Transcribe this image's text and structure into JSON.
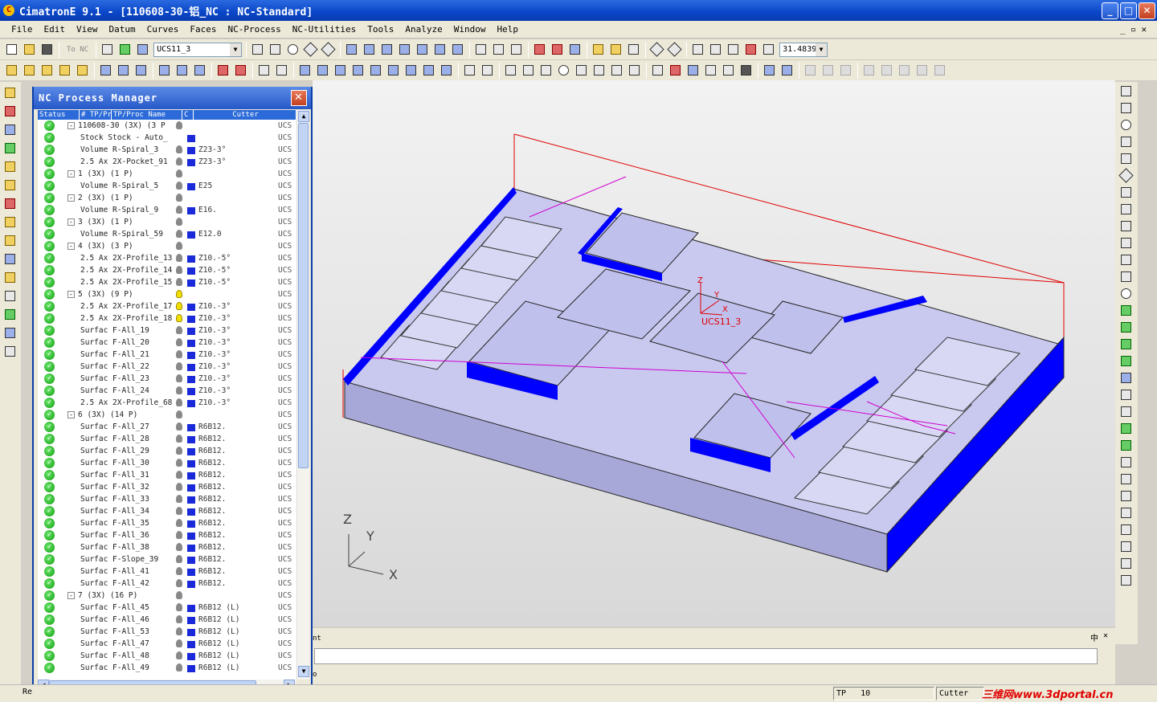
{
  "app": {
    "title": "CimatronE 9.1 - [110608-30-铝_NC : NC-Standard]",
    "icon_letter": "C"
  },
  "window_controls": {
    "minimize": "_",
    "maximize": "□",
    "close": "✕"
  },
  "menu": [
    "File",
    "Edit",
    "View",
    "Datum",
    "Curves",
    "Faces",
    "NC-Process",
    "NC-Utilities",
    "Tools",
    "Analyze",
    "Window",
    "Help"
  ],
  "mdi_controls": "_ ▫ ✕",
  "toolbar": {
    "to_nc_label": "To NC",
    "ucs_combo": "UCS11_3",
    "zoom_combo": "31.4839"
  },
  "nc_manager": {
    "title": "NC Process Manager",
    "columns": [
      "Status",
      "# TP/Pr",
      "TP/Proc Name",
      "C",
      "Cutter"
    ],
    "rows": [
      {
        "level": 0,
        "name": "110608-30  (3X)  (3 P",
        "status": "check",
        "expand": "-",
        "bulb": "grey",
        "sq": false,
        "cutter": "",
        "ucs": "UCS"
      },
      {
        "level": 1,
        "name": "Stock  Stock - Auto_",
        "status": "check",
        "expand": "",
        "bulb": "",
        "sq": true,
        "cutter": "",
        "ucs": "UCS"
      },
      {
        "level": 1,
        "name": "Volume R-Spiral_3",
        "status": "check",
        "expand": "",
        "bulb": "grey",
        "sq": true,
        "cutter": "Z23-3°",
        "ucs": "UCS"
      },
      {
        "level": 1,
        "name": "2.5 Ax 2X-Pocket_91",
        "status": "check",
        "expand": "",
        "bulb": "grey",
        "sq": true,
        "cutter": "Z23-3°",
        "ucs": "UCS"
      },
      {
        "level": 0,
        "name": "1  (3X)  (1 P)",
        "status": "check",
        "expand": "-",
        "bulb": "grey",
        "sq": false,
        "cutter": "",
        "ucs": "UCS"
      },
      {
        "level": 1,
        "name": "Volume R-Spiral_5",
        "status": "check",
        "expand": "",
        "bulb": "grey",
        "sq": true,
        "cutter": "E25",
        "ucs": "UCS"
      },
      {
        "level": 0,
        "name": "2  (3X)  (1 P)",
        "status": "check",
        "expand": "-",
        "bulb": "grey",
        "sq": false,
        "cutter": "",
        "ucs": "UCS"
      },
      {
        "level": 1,
        "name": "Volume R-Spiral_9",
        "status": "check",
        "expand": "",
        "bulb": "grey",
        "sq": true,
        "cutter": "E16.",
        "ucs": "UCS"
      },
      {
        "level": 0,
        "name": "3  (3X)  (1 P)",
        "status": "check",
        "expand": "-",
        "bulb": "grey",
        "sq": false,
        "cutter": "",
        "ucs": "UCS"
      },
      {
        "level": 1,
        "name": "Volume R-Spiral_59",
        "status": "check",
        "expand": "",
        "bulb": "grey",
        "sq": true,
        "cutter": "E12.0",
        "ucs": "UCS"
      },
      {
        "level": 0,
        "name": "4  (3X)  (3 P)",
        "status": "check",
        "expand": "-",
        "bulb": "grey",
        "sq": false,
        "cutter": "",
        "ucs": "UCS"
      },
      {
        "level": 1,
        "name": "2.5 Ax 2X-Profile_13",
        "status": "check",
        "expand": "",
        "bulb": "grey",
        "sq": true,
        "cutter": "Z10.-5°",
        "ucs": "UCS"
      },
      {
        "level": 1,
        "name": "2.5 Ax 2X-Profile_14",
        "status": "check",
        "expand": "",
        "bulb": "grey",
        "sq": true,
        "cutter": "Z10.-5°",
        "ucs": "UCS"
      },
      {
        "level": 1,
        "name": "2.5 Ax 2X-Profile_15",
        "status": "check",
        "expand": "",
        "bulb": "grey",
        "sq": true,
        "cutter": "Z10.-5°",
        "ucs": "UCS"
      },
      {
        "level": 0,
        "name": "5  (3X)  (9 P)",
        "status": "check",
        "expand": "-",
        "bulb": "yellow",
        "sq": false,
        "cutter": "",
        "ucs": "UCS"
      },
      {
        "level": 1,
        "name": "2.5 Ax 2X-Profile_17",
        "status": "check",
        "expand": "",
        "bulb": "yellow",
        "sq": true,
        "cutter": "Z10.-3°",
        "ucs": "UCS"
      },
      {
        "level": 1,
        "name": "2.5 Ax 2X-Profile_18",
        "status": "check",
        "expand": "",
        "bulb": "yellow",
        "sq": true,
        "cutter": "Z10.-3°",
        "ucs": "UCS"
      },
      {
        "level": 1,
        "name": "Surfac F-All_19",
        "status": "check",
        "expand": "",
        "bulb": "grey",
        "sq": true,
        "cutter": "Z10.-3°",
        "ucs": "UCS"
      },
      {
        "level": 1,
        "name": "Surfac F-All_20",
        "status": "check",
        "expand": "",
        "bulb": "grey",
        "sq": true,
        "cutter": "Z10.-3°",
        "ucs": "UCS"
      },
      {
        "level": 1,
        "name": "Surfac F-All_21",
        "status": "check",
        "expand": "",
        "bulb": "grey",
        "sq": true,
        "cutter": "Z10.-3°",
        "ucs": "UCS"
      },
      {
        "level": 1,
        "name": "Surfac F-All_22",
        "status": "check",
        "expand": "",
        "bulb": "grey",
        "sq": true,
        "cutter": "Z10.-3°",
        "ucs": "UCS"
      },
      {
        "level": 1,
        "name": "Surfac F-All_23",
        "status": "check",
        "expand": "",
        "bulb": "grey",
        "sq": true,
        "cutter": "Z10.-3°",
        "ucs": "UCS"
      },
      {
        "level": 1,
        "name": "Surfac F-All_24",
        "status": "check",
        "expand": "",
        "bulb": "grey",
        "sq": true,
        "cutter": "Z10.-3°",
        "ucs": "UCS"
      },
      {
        "level": 1,
        "name": "2.5 Ax 2X-Profile_68",
        "status": "check",
        "expand": "",
        "bulb": "grey",
        "sq": true,
        "cutter": "Z10.-3°",
        "ucs": "UCS"
      },
      {
        "level": 0,
        "name": "6  (3X)  (14 P)",
        "status": "check",
        "expand": "-",
        "bulb": "grey",
        "sq": false,
        "cutter": "",
        "ucs": "UCS"
      },
      {
        "level": 1,
        "name": "Surfac F-All_27",
        "status": "check",
        "expand": "",
        "bulb": "grey",
        "sq": true,
        "cutter": "R6B12.",
        "ucs": "UCS"
      },
      {
        "level": 1,
        "name": "Surfac F-All_28",
        "status": "check",
        "expand": "",
        "bulb": "grey",
        "sq": true,
        "cutter": "R6B12.",
        "ucs": "UCS"
      },
      {
        "level": 1,
        "name": "Surfac F-All_29",
        "status": "check",
        "expand": "",
        "bulb": "grey",
        "sq": true,
        "cutter": "R6B12.",
        "ucs": "UCS"
      },
      {
        "level": 1,
        "name": "Surfac F-All_30",
        "status": "check",
        "expand": "",
        "bulb": "grey",
        "sq": true,
        "cutter": "R6B12.",
        "ucs": "UCS"
      },
      {
        "level": 1,
        "name": "Surfac F-All_31",
        "status": "check",
        "expand": "",
        "bulb": "grey",
        "sq": true,
        "cutter": "R6B12.",
        "ucs": "UCS"
      },
      {
        "level": 1,
        "name": "Surfac F-All_32",
        "status": "check",
        "expand": "",
        "bulb": "grey",
        "sq": true,
        "cutter": "R6B12.",
        "ucs": "UCS"
      },
      {
        "level": 1,
        "name": "Surfac F-All_33",
        "status": "check",
        "expand": "",
        "bulb": "grey",
        "sq": true,
        "cutter": "R6B12.",
        "ucs": "UCS"
      },
      {
        "level": 1,
        "name": "Surfac F-All_34",
        "status": "check",
        "expand": "",
        "bulb": "grey",
        "sq": true,
        "cutter": "R6B12.",
        "ucs": "UCS"
      },
      {
        "level": 1,
        "name": "Surfac F-All_35",
        "status": "check",
        "expand": "",
        "bulb": "grey",
        "sq": true,
        "cutter": "R6B12.",
        "ucs": "UCS"
      },
      {
        "level": 1,
        "name": "Surfac F-All_36",
        "status": "check",
        "expand": "",
        "bulb": "grey",
        "sq": true,
        "cutter": "R6B12.",
        "ucs": "UCS"
      },
      {
        "level": 1,
        "name": "Surfac F-All_38",
        "status": "check",
        "expand": "",
        "bulb": "grey",
        "sq": true,
        "cutter": "R6B12.",
        "ucs": "UCS"
      },
      {
        "level": 1,
        "name": "Surfac F-Slope_39",
        "status": "check",
        "expand": "",
        "bulb": "grey",
        "sq": true,
        "cutter": "R6B12.",
        "ucs": "UCS"
      },
      {
        "level": 1,
        "name": "Surfac F-All_41",
        "status": "check",
        "expand": "",
        "bulb": "grey",
        "sq": true,
        "cutter": "R6B12.",
        "ucs": "UCS"
      },
      {
        "level": 1,
        "name": "Surfac F-All_42",
        "status": "check",
        "expand": "",
        "bulb": "grey",
        "sq": true,
        "cutter": "R6B12.",
        "ucs": "UCS"
      },
      {
        "level": 0,
        "name": "7  (3X)  (16 P)",
        "status": "check",
        "expand": "-",
        "bulb": "grey",
        "sq": false,
        "cutter": "",
        "ucs": "UCS"
      },
      {
        "level": 1,
        "name": "Surfac F-All_45",
        "status": "check",
        "expand": "",
        "bulb": "grey",
        "sq": true,
        "cutter": "R6B12 (L)",
        "ucs": "UCS"
      },
      {
        "level": 1,
        "name": "Surfac F-All_46",
        "status": "check",
        "expand": "",
        "bulb": "grey",
        "sq": true,
        "cutter": "R6B12 (L)",
        "ucs": "UCS"
      },
      {
        "level": 1,
        "name": "Surfac F-All_53",
        "status": "check",
        "expand": "",
        "bulb": "grey",
        "sq": true,
        "cutter": "R6B12 (L)",
        "ucs": "UCS"
      },
      {
        "level": 1,
        "name": "Surfac F-All_47",
        "status": "check",
        "expand": "",
        "bulb": "grey",
        "sq": true,
        "cutter": "R6B12 (L)",
        "ucs": "UCS"
      },
      {
        "level": 1,
        "name": "Surfac F-All_48",
        "status": "check",
        "expand": "",
        "bulb": "grey",
        "sq": true,
        "cutter": "R6B12 (L)",
        "ucs": "UCS"
      },
      {
        "level": 1,
        "name": "Surfac F-All_49",
        "status": "check",
        "expand": "",
        "bulb": "grey",
        "sq": true,
        "cutter": "R6B12 (L)",
        "ucs": "UCS"
      }
    ]
  },
  "viewport": {
    "ucs_label": "UCS11_3",
    "triad": {
      "z": "Z",
      "y": "Y",
      "x": "X"
    },
    "local_axes": {
      "z": "Z",
      "y": "Y",
      "x": "X"
    }
  },
  "bottom_pane": {
    "fragment": "nt",
    "pin": "中",
    "close": "✕",
    "o_label": "o"
  },
  "status": {
    "left": "Re",
    "tp_label": "TP",
    "tp_value": "10",
    "cutter_label": "Cutter",
    "watermark": "三维网www.3dportal.cn"
  },
  "colors": {
    "titlebar": "#0a46c8",
    "part_blue": "#0000ff",
    "part_face": "#c9c9ef",
    "boundary_red": "#e00000",
    "toolpath_magenta": "#d000d0"
  }
}
